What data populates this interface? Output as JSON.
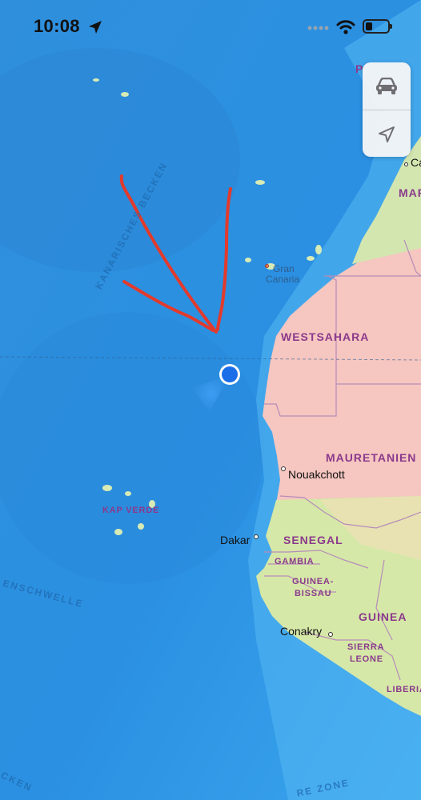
{
  "status_bar": {
    "time": "10:08",
    "icons": [
      "location-arrow-icon",
      "signal-dots-icon",
      "wifi-icon",
      "battery-icon"
    ]
  },
  "map_controls": {
    "buttons": [
      {
        "name": "driving-mode-button",
        "icon": "car-icon"
      },
      {
        "name": "current-location-button",
        "icon": "location-arrow-icon"
      }
    ]
  },
  "map": {
    "colors": {
      "ocean": "#2a8fe0",
      "sahara": "#f6c6c0",
      "green_land": "#c9e3a8",
      "annotation_arrow": "#e23a2c",
      "user_location": "#1a6ee8"
    },
    "countries": [
      "WESTSAHARA",
      "MAURETANIEN",
      "SENEGAL",
      "GAMBIA",
      "GUINEA-BISSAU",
      "GUINEA",
      "SIERRA LEONE",
      "LIBERIA",
      "KAP VERDE"
    ],
    "labels": {
      "westsahara": "WESTSAHARA",
      "mauretanien": "MAURETANIEN",
      "senegal": "SENEGAL",
      "gambia": "GAMBIA",
      "guinea_bissau_1": "GUINEA-",
      "guinea_bissau_2": "BISSAU",
      "guinea": "GUINEA",
      "sierra_leone_1": "SIERRA",
      "sierra_leone_2": "LEONE",
      "liberia": "LIBERIA",
      "kap_verde": "KAP VERDE",
      "gran_canaria_1": "Gran",
      "gran_canaria_2": "Canaria",
      "nouakchott": "Nouakchott",
      "dakar": "Dakar",
      "conakry": "Conakry",
      "ocean_basin": "KANARISCHES BECKEN",
      "ocean_rise": "ENSCHWELLE",
      "ocean_bottom_left": "CKEN",
      "ocean_zone": "RE ZONE",
      "edge_ca": "Ca",
      "edge_mar": "MAR",
      "edge_p": "P"
    }
  }
}
